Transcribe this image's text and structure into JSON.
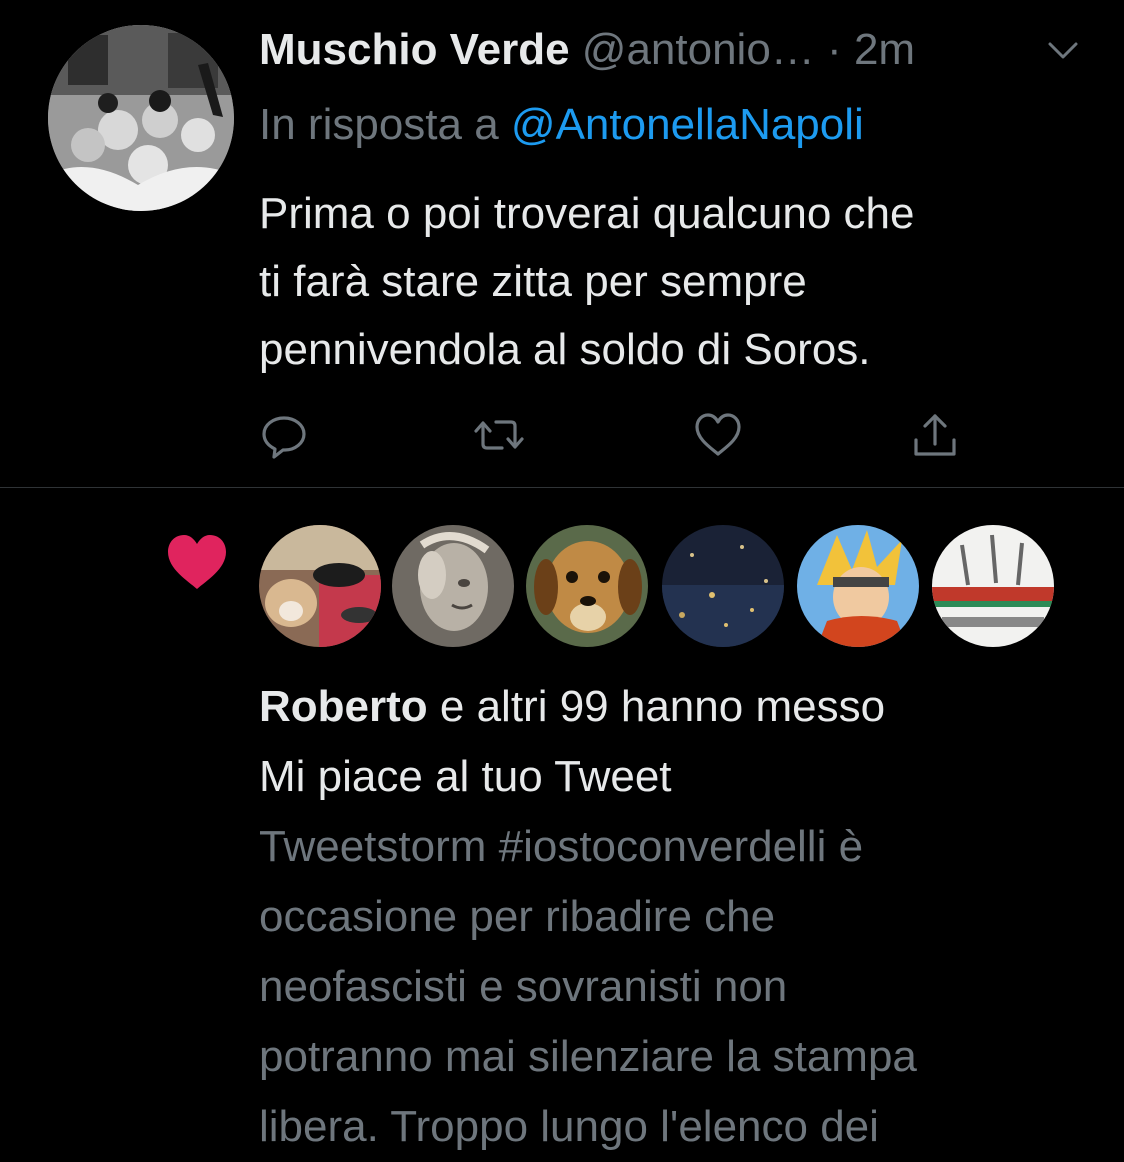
{
  "tweet": {
    "author_name": "Muschio Verde",
    "author_handle": "@antonio…",
    "separator": "·",
    "time": "2m",
    "reply_prefix": "In risposta a",
    "reply_mention": "@AntonellaNapoli",
    "text_lines": [
      "Prima o poi troverai qualcuno che",
      "ti farà stare zitta per sempre",
      "pennivendola al soldo di Soros."
    ],
    "actions": [
      "reply-icon",
      "retweet-icon",
      "like-icon",
      "share-icon"
    ]
  },
  "notification": {
    "icon": "heart-icon",
    "icon_color": "#e0245e",
    "liker_count": 6,
    "actor": "Roberto",
    "line1_rest": " e altri 99 hanno messo",
    "line2": "Mi piace al tuo Tweet",
    "quoted_lines": [
      "Tweetstorm #iostoconverdelli è",
      "occasione per ribadire che",
      "neofascisti e sovranisti non",
      "potranno mai silenziare la stampa",
      "libera. Troppo lungo l'elenco dei"
    ]
  },
  "colors": {
    "background": "#000000",
    "text_primary": "#e7e9ea",
    "text_secondary": "#6e767d",
    "link": "#1d9bf0",
    "divider": "#2f3336",
    "like_red": "#e0245e"
  }
}
